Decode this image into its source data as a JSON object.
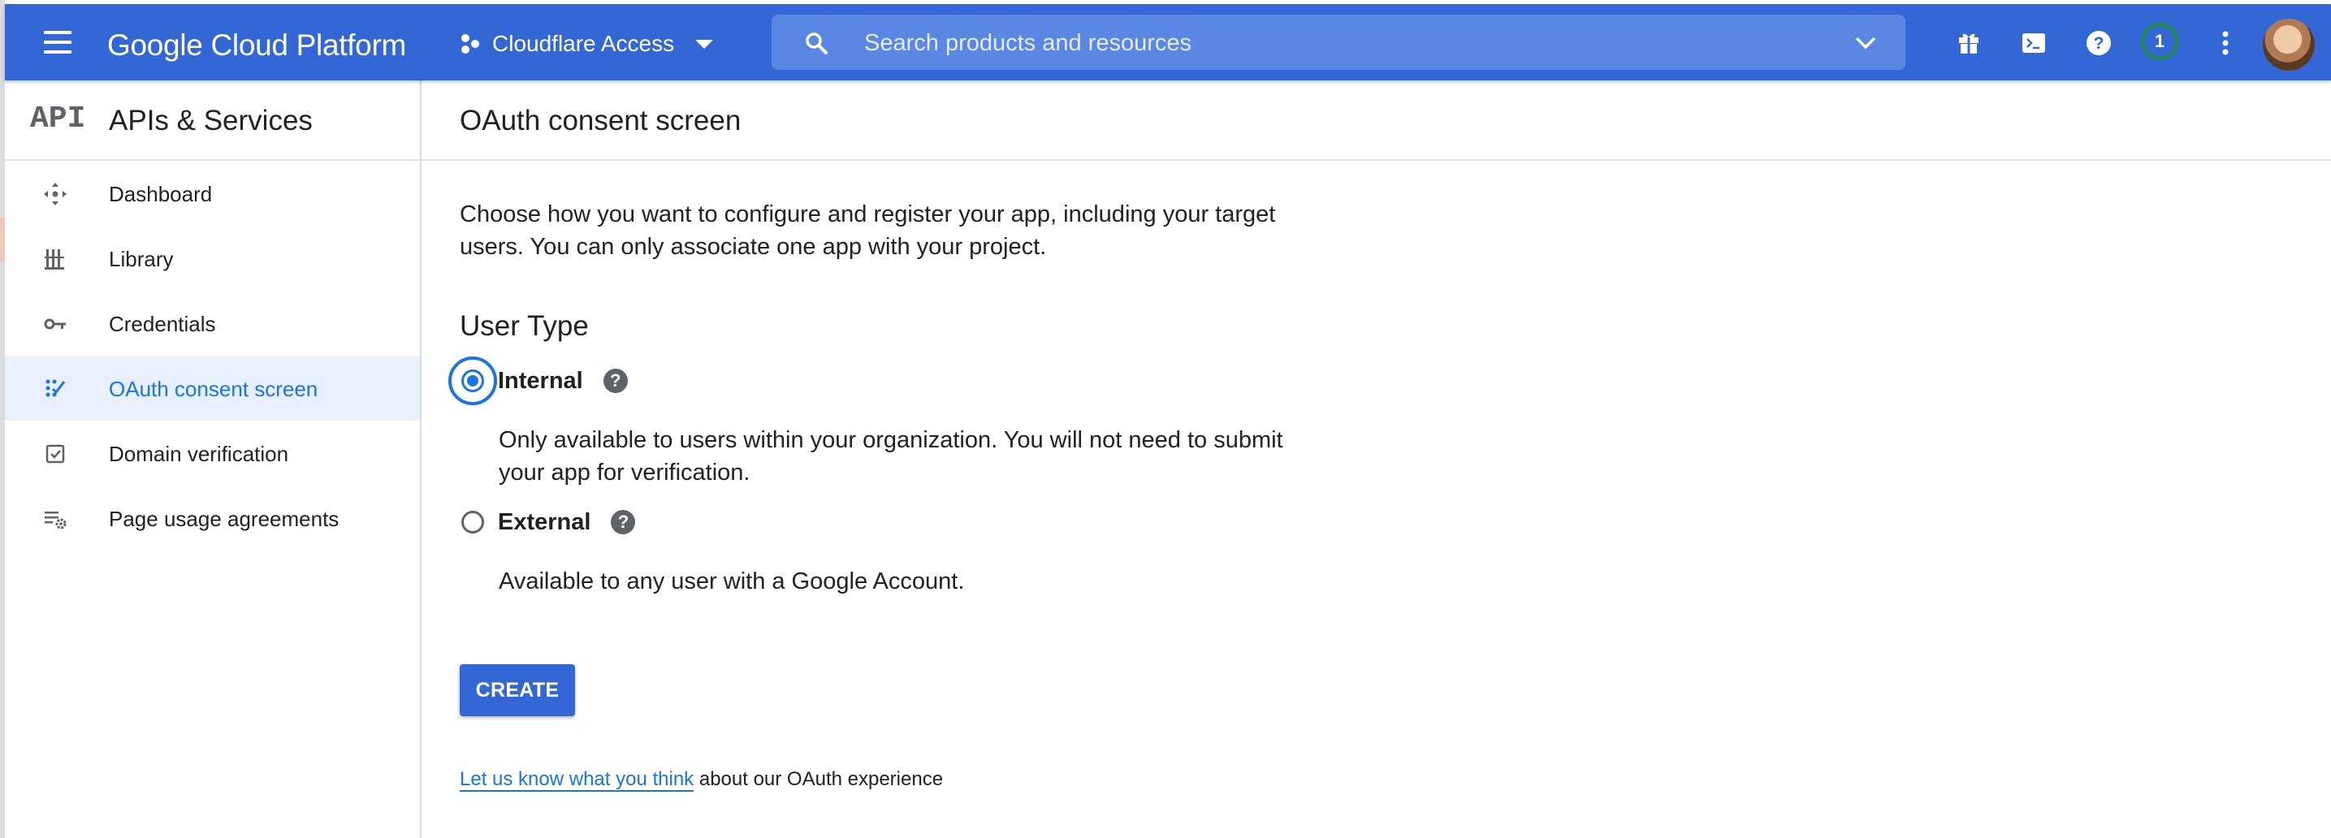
{
  "colors": {
    "topbar": "#3367d6",
    "accent": "#1a73e8",
    "active_bg": "#e8f0fe",
    "notification_ring": "#1e8e3e"
  },
  "topbar": {
    "brand": "Google Cloud Platform",
    "project_name": "Cloudflare Access",
    "search_placeholder": "Search products and resources",
    "notification_count": "1",
    "icons": [
      "menu-icon",
      "project-icon",
      "search-icon",
      "chevron-down-icon",
      "gift-icon",
      "cloud-shell-icon",
      "help-icon",
      "more-vert-icon"
    ]
  },
  "sidebar": {
    "logo_text": "API",
    "title": "APIs & Services",
    "items": [
      {
        "label": "Dashboard",
        "icon": "dashboard-icon",
        "active": false
      },
      {
        "label": "Library",
        "icon": "library-icon",
        "active": false
      },
      {
        "label": "Credentials",
        "icon": "key-icon",
        "active": false
      },
      {
        "label": "OAuth consent screen",
        "icon": "consent-icon",
        "active": true
      },
      {
        "label": "Domain verification",
        "icon": "checkbox-icon",
        "active": false
      },
      {
        "label": "Page usage agreements",
        "icon": "settings-list-icon",
        "active": false
      }
    ]
  },
  "main": {
    "title": "OAuth consent screen",
    "intro": "Choose how you want to configure and register your app, including your target users. You can only associate one app with your project.",
    "user_type_heading": "User Type",
    "options": [
      {
        "label": "Internal",
        "description": "Only available to users within your organization. You will not need to submit your app for verification.",
        "selected": true
      },
      {
        "label": "External",
        "description": "Available to any user with a Google Account.",
        "selected": false
      }
    ],
    "create_label": "CREATE",
    "feedback_link": "Let us know what you think",
    "feedback_text": " about our OAuth experience"
  }
}
